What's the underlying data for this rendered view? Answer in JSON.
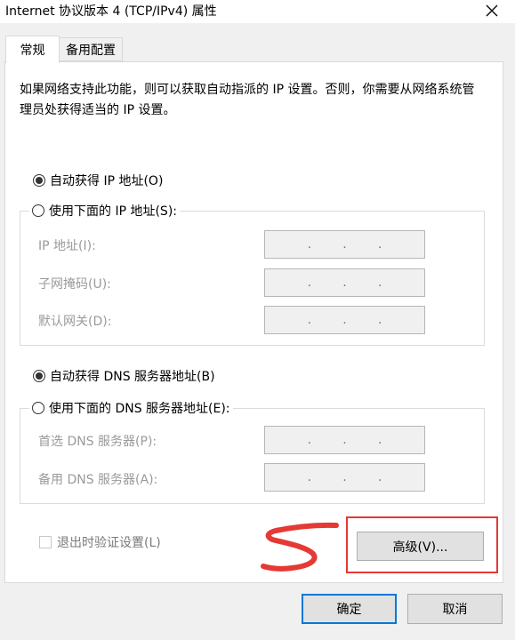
{
  "window": {
    "title": "Internet 协议版本 4 (TCP/IPv4) 属性",
    "close_icon": "close-icon"
  },
  "tabs": [
    {
      "label": "常规",
      "active": true
    },
    {
      "label": "备用配置",
      "active": false
    }
  ],
  "description": "如果网络支持此功能，则可以获取自动指派的 IP 设置。否则，你需要从网络系统管理员处获得适当的 IP 设置。",
  "ip_section": {
    "auto_radio_label": "自动获得 IP 地址(O)",
    "auto_selected": true,
    "manual_radio_label": "使用下面的 IP 地址(S):",
    "fields": [
      {
        "label": "IP 地址(I):",
        "value": "   .   .   ."
      },
      {
        "label": "子网掩码(U):",
        "value": "   .   .   ."
      },
      {
        "label": "默认网关(D):",
        "value": "   .   .   ."
      }
    ]
  },
  "dns_section": {
    "auto_radio_label": "自动获得 DNS 服务器地址(B)",
    "auto_selected": true,
    "manual_radio_label": "使用下面的 DNS 服务器地址(E):",
    "fields": [
      {
        "label": "首选 DNS 服务器(P):",
        "value": "   .   .   ."
      },
      {
        "label": "备用 DNS 服务器(A):",
        "value": "   .   .   ."
      }
    ]
  },
  "validate_checkbox": {
    "label": "退出时验证设置(L)",
    "checked": false,
    "enabled": false
  },
  "buttons": {
    "advanced": "高级(V)...",
    "ok": "确定",
    "cancel": "取消"
  },
  "colors": {
    "annotation_red": "#e53935",
    "primary_border": "#0078d7"
  }
}
